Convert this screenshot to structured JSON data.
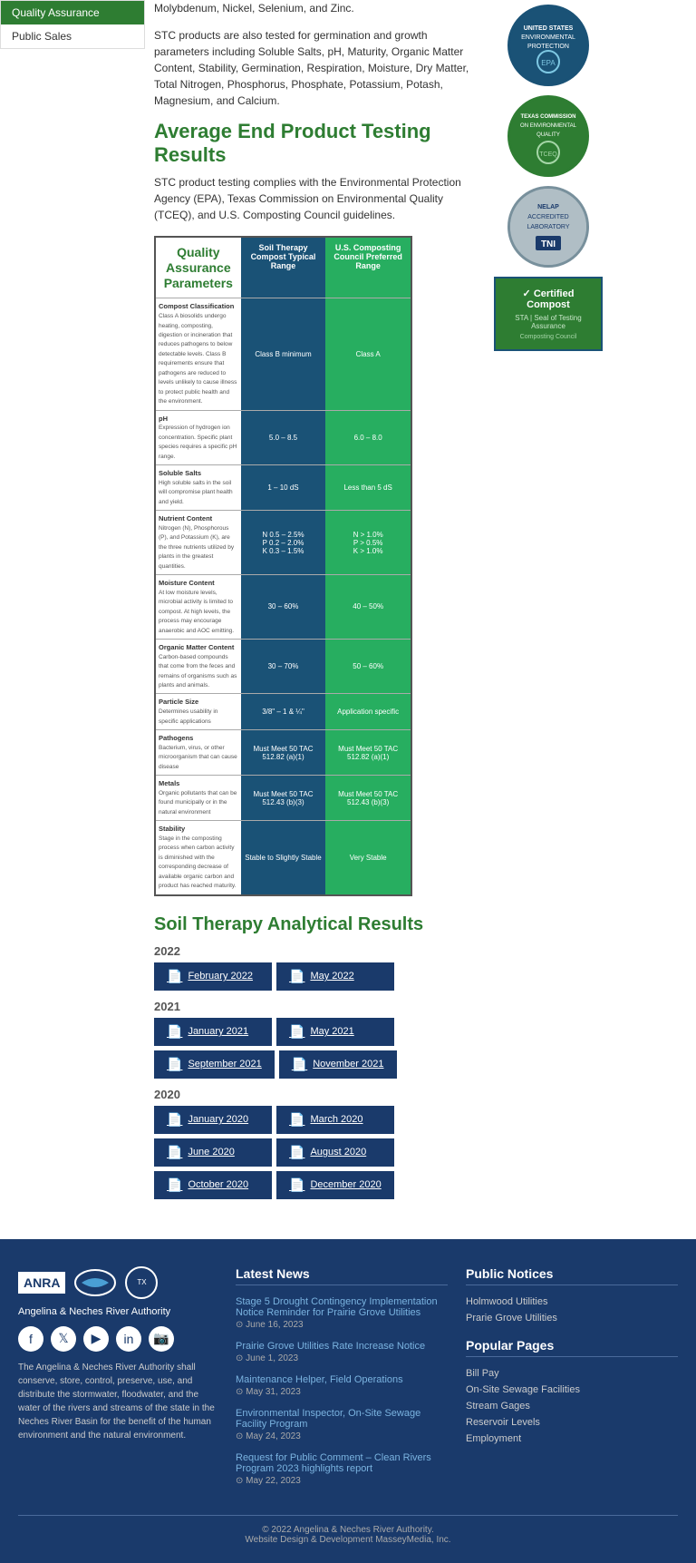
{
  "sidebar": {
    "items": [
      {
        "id": "quality-assurance",
        "label": "Quality Assurance",
        "active": true
      },
      {
        "id": "public-sales",
        "label": "Public Sales",
        "active": false
      }
    ]
  },
  "intro": {
    "text": "Molybdenum, Nickel, Selenium, and Zinc.",
    "para2": "STC products are also tested for germination and growth parameters including Soluble Salts, pH, Maturity, Organic Matter Content, Stability, Germination, Respiration, Moisture, Dry Matter, Total Nitrogen, Phosphorus, Phosphate, Potassium, Potash, Magnesium, and Calcium."
  },
  "section": {
    "heading": "Average End Product Testing Results",
    "sub_text": "STC product testing complies with the Environmental Protection Agency (EPA), Texas Commission on Environmental Quality (TCEQ), and U.S. Composting Council guidelines."
  },
  "qa_table": {
    "title_line1": "Quality",
    "title_line2": "Assurance",
    "title_line3": "Parameters",
    "col1_header": "Soil Therapy Compost Typical Range",
    "col2_header": "U.S. Composting Council Preferred Range",
    "rows": [
      {
        "label_title": "Compost Classification",
        "label_desc": "Class A biosolids undergo heating, composting, digestion or incineration that reduces pathogens to below detectable levels. Class B requirements ensure that pathogens are reduced to levels unlikely to cause illness to protect public health and the environment.",
        "col1": "Class B minimum",
        "col2": "Class A"
      },
      {
        "label_title": "pH",
        "label_desc": "Expression of hydrogen ion concentration. Specific plant species requires a specific pH range.",
        "col1": "5.0 – 8.5",
        "col2": "6.0 – 8.0"
      },
      {
        "label_title": "Soluble Salts",
        "label_desc": "High soluble salts in the soil will compromise plant health and yield.",
        "col1": "1 – 10 dS",
        "col2": "Less than 5 dS"
      },
      {
        "label_title": "Nutrient Content",
        "label_desc": "Nitrogen (N), Phosphorous (P), and Potassium (K), are the three nutrients utilized by plants in the greatest quantities.",
        "col1": "N 0.5 – 2.5%\nP 0.2 – 2.0%\nK 0.3 – 1.5%",
        "col2": "N > 1.0%\nP > 0.5%\nK > 1.0%"
      },
      {
        "label_title": "Moisture Content",
        "label_desc": "At low moisture levels, microbial activity is limited to compost. At high levels, the process may encourage anaerobic and AOC emitting.",
        "col1": "30 – 60%",
        "col2": "40 – 50%"
      },
      {
        "label_title": "Organic Matter Content",
        "label_desc": "Carbon-based compounds that come from the feces and remains of organisms such as plants and animals.",
        "col1": "30 – 70%",
        "col2": "50 – 60%"
      },
      {
        "label_title": "Particle Size",
        "label_desc": "Determines usability in specific applications",
        "col1": "3/8\" – 1 & ¼\"",
        "col2": "Application specific"
      },
      {
        "label_title": "Pathogens",
        "label_desc": "Bacterium, virus, or other microorganism that can cause disease",
        "col1": "Must Meet 50 TAC 512.82 (a)(1)",
        "col2": "Must Meet 50 TAC 512.82 (a)(1)"
      },
      {
        "label_title": "Metals",
        "label_desc": "Organic pollutants that can be found municipally or in the natural environment",
        "col1": "Must Meet 50 TAC 512.43 (b)(3)",
        "col2": "Must Meet 50 TAC 512.43 (b)(3)"
      },
      {
        "label_title": "Stability",
        "label_desc": "Stage in the composting process when carbon activity is diminished with the corresponding decrease of available organic carbon and product has reached maturity.",
        "col1": "Stable to Slightly Stable",
        "col2": "Very Stable"
      }
    ]
  },
  "soil_results": {
    "heading": "Soil Therapy Analytical Results",
    "years": [
      {
        "year": "2022",
        "docs": [
          {
            "label": "February 2022"
          },
          {
            "label": "May 2022"
          }
        ]
      },
      {
        "year": "2021",
        "docs": [
          {
            "label": "January 2021"
          },
          {
            "label": "May 2021"
          },
          {
            "label": "September 2021"
          },
          {
            "label": "November 2021"
          }
        ]
      },
      {
        "year": "2020",
        "docs": [
          {
            "label": "January 2020"
          },
          {
            "label": "March 2020"
          },
          {
            "label": "June 2020"
          },
          {
            "label": "August 2020"
          },
          {
            "label": "October 2020"
          },
          {
            "label": "December 2020"
          }
        ]
      }
    ]
  },
  "logos": {
    "epa": {
      "line1": "UNITED STATES",
      "line2": "ENVIRONMENTAL",
      "line3": "PROTECTION"
    },
    "tceq": {
      "line1": "TEXAS COMMISSION",
      "line2": "ON ENVIRONMENTAL",
      "line3": "QUALITY"
    },
    "tni": {
      "line1": "NELAP",
      "line2": "ACCREDITED",
      "line3": "LABORATORY",
      "sub": "TNI"
    },
    "certified": {
      "title": "Certified Compost",
      "sub": "STA | Seal of Testing Assurance",
      "org": "Composting Council"
    }
  },
  "footer": {
    "org_name": "Angelina & Neches River Authority",
    "description": "The Angelina & Neches River Authority shall conserve, store, control, preserve, use, and distribute the stormwater, floodwater, and the water of the rivers and streams of the state in the Neches River Basin for the benefit of the human environment and the natural environment.",
    "latest_news": {
      "title": "Latest News",
      "items": [
        {
          "headline": "Stage 5 Drought Contingency Implementation Notice Reminder for Prairie Grove Utilities",
          "date": "June 16, 2023"
        },
        {
          "headline": "Prairie Grove Utilities Rate Increase Notice",
          "date": "June 1, 2023"
        },
        {
          "headline": "Maintenance Helper, Field Operations",
          "date": "May 31, 2023"
        },
        {
          "headline": "Environmental Inspector, On-Site Sewage Facility Program",
          "date": "May 24, 2023"
        },
        {
          "headline": "Request for Public Comment – Clean Rivers Program 2023 highlights report",
          "date": "May 22, 2023"
        }
      ]
    },
    "public_notices": {
      "title": "Public Notices",
      "items": [
        {
          "label": "Holmwood Utilities"
        },
        {
          "label": "Prarie Grove Utilities"
        }
      ]
    },
    "popular_pages": {
      "title": "Popular Pages",
      "items": [
        {
          "label": "Bill Pay"
        },
        {
          "label": "On-Site Sewage Facilities"
        },
        {
          "label": "Stream Gages"
        },
        {
          "label": "Reservoir Levels"
        },
        {
          "label": "Employment"
        }
      ]
    },
    "copyright": "© 2022 Angelina & Neches River Authority.",
    "design_credit": "Website Design & Development MasseyMedia, Inc."
  }
}
